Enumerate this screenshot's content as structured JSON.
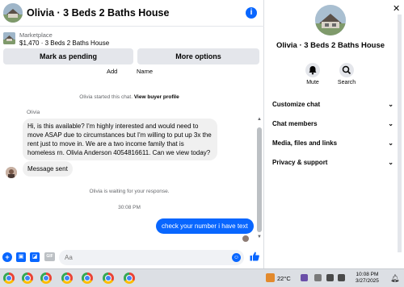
{
  "chat": {
    "title": "Olivia · 3 Beds 2 Baths House",
    "info_icon": "i"
  },
  "listing": {
    "label": "Marketplace",
    "price_title": "$1,470 · 3 Beds 2 Baths House",
    "mark_pending": "Mark as pending",
    "more_options": "More options"
  },
  "columns": {
    "add": "Add",
    "name": "Name"
  },
  "messages": {
    "started_prefix": "Olivia started this chat. ",
    "view_profile": "View buyer profile",
    "sender": "Olivia",
    "incoming_1": "Hi, is this available? I'm highly interested and would need to move ASAP due to circumstances but I'm willing to put up 3x the rent just to move in. We are a two income family that is homeless rn. Olivia Anderson 4054816611. Can we view today?",
    "incoming_2": "Message sent",
    "waiting": "Olivia is waiting for your response.",
    "time": "30:08 PM",
    "outgoing_1": "check your number i have text"
  },
  "composer": {
    "placeholder": "Aa",
    "gif_label": "GIF"
  },
  "right_panel": {
    "title": "Olivia · 3 Beds 2 Baths House",
    "mute_label": "Mute",
    "search_label": "Search",
    "sections": [
      "Customize chat",
      "Chat members",
      "Media, files and links",
      "Privacy & support"
    ]
  },
  "taskbar": {
    "temperature": "22°C",
    "time": "10:08 PM",
    "date": "3/27/2025"
  },
  "colors": {
    "accent": "#0866ff",
    "bubble_in": "#f0f0f0",
    "button_bg": "#e4e6eb"
  }
}
